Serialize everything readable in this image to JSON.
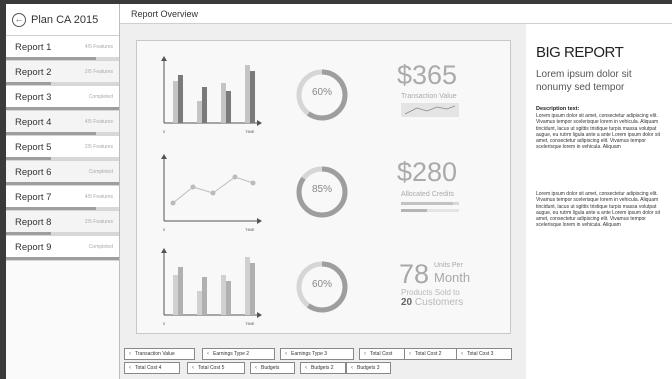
{
  "sidebar": {
    "title": "Plan CA 2015",
    "items": [
      {
        "label": "Report 1",
        "meta": "4/5 Features",
        "progress": 0.8
      },
      {
        "label": "Report 2",
        "meta": "2/5 Features",
        "progress": 0.4
      },
      {
        "label": "Report 3",
        "meta": "Completed",
        "progress": 1.0
      },
      {
        "label": "Report 4",
        "meta": "4/5 Features",
        "progress": 0.8
      },
      {
        "label": "Report 5",
        "meta": "2/5 Features",
        "progress": 0.4
      },
      {
        "label": "Report 6",
        "meta": "Completed",
        "progress": 1.0
      },
      {
        "label": "Report 7",
        "meta": "4/5 Features",
        "progress": 0.8
      },
      {
        "label": "Report 8",
        "meta": "2/5 Features",
        "progress": 0.4
      },
      {
        "label": "Report 9",
        "meta": "Completed",
        "progress": 1.0
      }
    ]
  },
  "header": {
    "title": "Report Overview"
  },
  "rows": [
    {
      "ring": "60%",
      "ring_value": 0.6,
      "value": "$365",
      "caption": "Transaction Value"
    },
    {
      "ring": "85%",
      "ring_value": 0.85,
      "value": "$280",
      "caption": "Allocated Credits"
    },
    {
      "ring": "60%",
      "ring_value": 0.6,
      "value": "78",
      "units": "Units Per",
      "units2": "Month",
      "sub1": "Products Sold to",
      "sub2_num": "20",
      "sub2_text": "Customers"
    }
  ],
  "axis": {
    "zero": "0",
    "time": "TIME"
  },
  "chips": [
    "Transaction Value",
    "Earnings Type 2",
    "Earnings Type 3",
    "Total Cost",
    "Total Cost 2",
    "Total Cost 3",
    "Total Cost 4",
    "Total Cost 5",
    "Budgets",
    "Budgets 2",
    "Budgets 3"
  ],
  "right": {
    "big_title": "BIG REPORT",
    "lorem": "Lorem ipsum dolor sit nonumy sed tempor",
    "desc_title": "Description text:",
    "desc1": "Lorem ipsum dolor sit amet, consectetur adipiscing elit. Vivamus tempor scelerisque lorem in vehicula. Aliquam tincidunt, lacus ut sgittis tristique turpis massa volutpat augue, eu rutrm ligula ante a ante Lorem ipsum dolor sit amet, consectetur adipiscing elit. Vivamus tempor scelerisque lorem in vehicula. Aliquam",
    "desc2": "Lorem ipsum dolor sit amet, consectetur adipiscing elit. Vivamus tempor scelerisque lorem in vehicula. Aliquam tincidunt, lacus ut sgittis tristique turpis massa volutpat augue, eu rutrm ligula ante a ante Lorem ipsum dolor sit amet, consectetur adipiscing elit. Vivamus tempor scelerisque lorem in vehicula. Aliquam"
  },
  "colors": {
    "bar_dark": "#7a7a7a",
    "bar_light": "#c4c4c4",
    "accent": "#9e9e9e"
  }
}
